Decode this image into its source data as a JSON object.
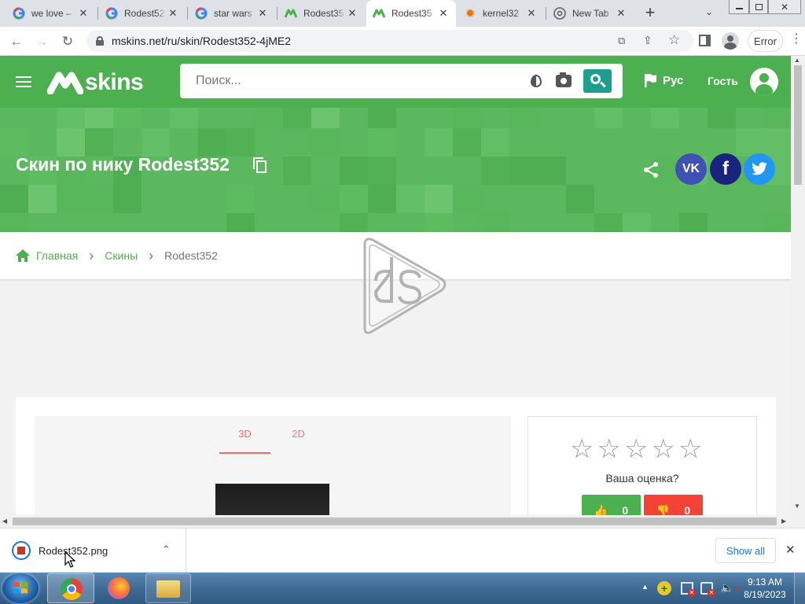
{
  "browser": {
    "tabs": [
      {
        "title": "we love –",
        "favicon": "google-g-icon",
        "active": false
      },
      {
        "title": "Rodest52",
        "favicon": "google-g-icon",
        "active": false
      },
      {
        "title": "star wars",
        "favicon": "google-g-icon",
        "active": false
      },
      {
        "title": "Rodest35",
        "favicon": "mskins-icon",
        "active": false
      },
      {
        "title": "Rodest35",
        "favicon": "mskins-icon",
        "active": true
      },
      {
        "title": "kernel32",
        "favicon": "gear-icon",
        "active": false
      },
      {
        "title": "New Tab",
        "favicon": "chrome-icon",
        "active": false
      }
    ],
    "new_tab_label": "+",
    "url": "mskins.net/ru/skin/Rodest352-4jME2",
    "profile_error": "Error"
  },
  "site": {
    "logo": "skins",
    "search_placeholder": "Поиск...",
    "language": "Рус",
    "guest": "Гость",
    "title": "Скин по нику Rodest352",
    "breadcrumb": [
      "Главная",
      "Скины",
      "Rodest352"
    ],
    "viewer_tabs": [
      "3D",
      "2D"
    ],
    "rating_label": "Ваша оценка?",
    "likes": "0",
    "dislikes": "0",
    "accent": "#4cb050",
    "tab_accent": "#ef6b6b"
  },
  "downloads": {
    "file": "Rodest352.png",
    "show_all": "Show all"
  },
  "taskbar": {
    "time": "9:13 AM",
    "date": "8/19/2023"
  }
}
